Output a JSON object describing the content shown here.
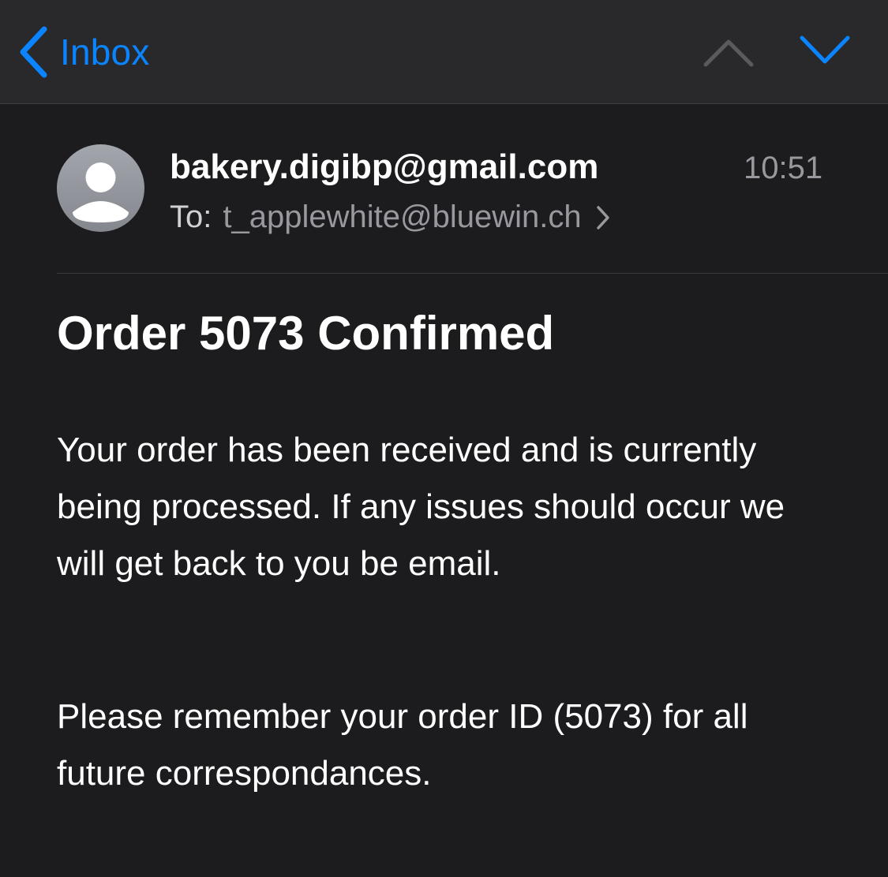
{
  "navbar": {
    "back_label": "Inbox",
    "back_icon": "chevron-left-icon",
    "prev_icon": "chevron-up-icon",
    "next_icon": "chevron-down-icon"
  },
  "message": {
    "sender": "bakery.digibp@gmail.com",
    "time": "10:51",
    "to_label": "To:",
    "recipient": "t_applewhite@bluewin.ch",
    "subject": "Order 5073 Confirmed",
    "body_paragraphs": [
      "Your order has been received and is currently being processed. If any issues should occur we will get back to you be email.",
      "Please remember your order ID (5073) for all future correspondances."
    ]
  },
  "colors": {
    "accent": "#0a84ff",
    "background": "#1c1c1e",
    "navbar_background": "#29292b",
    "secondary_text": "#98989f",
    "disabled_icon": "#5a5a5e"
  }
}
